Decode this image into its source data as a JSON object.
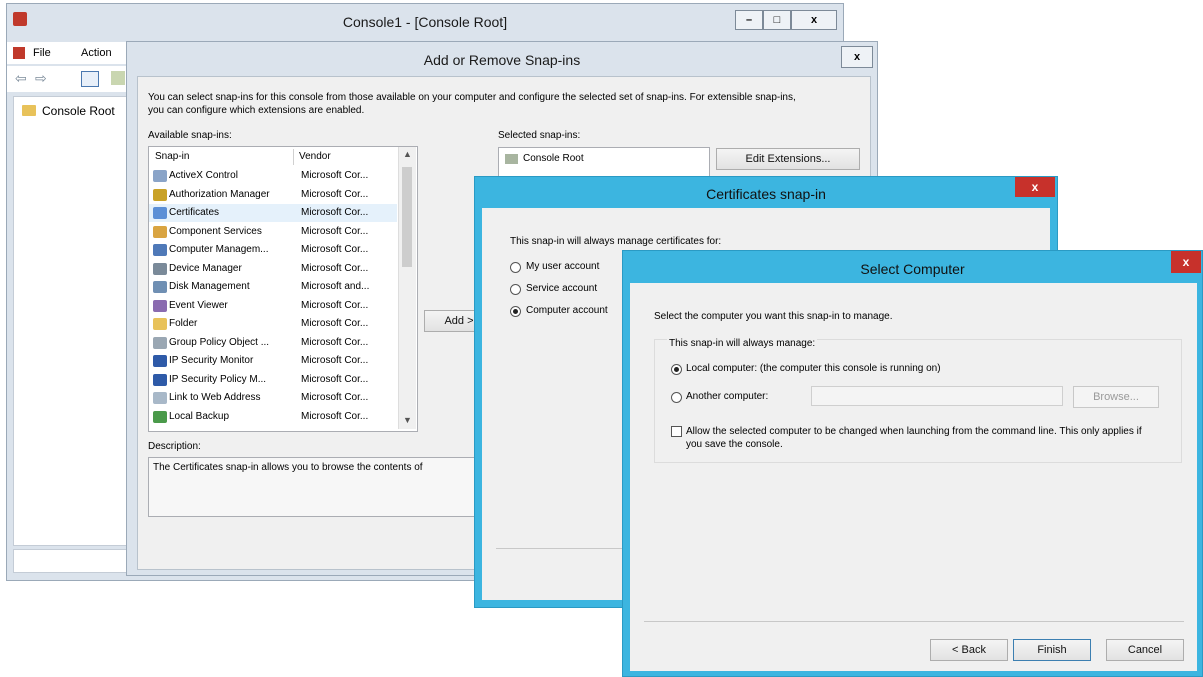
{
  "mmc": {
    "title": "Console1 - [Console Root]",
    "menu": [
      "File",
      "Action"
    ],
    "tree_root": "Console Root",
    "controls": {
      "minimize": "–",
      "maximize": "□",
      "close": "x"
    }
  },
  "add_remove": {
    "title": "Add or Remove Snap-ins",
    "close": "x",
    "intro": "You can select snap-ins for this console from those available on your computer and configure the selected set of snap-ins. For extensible snap-ins, you can configure which extensions are enabled.",
    "available_label": "Available snap-ins:",
    "columns": {
      "snapin": "Snap-in",
      "vendor": "Vendor"
    },
    "snapins": [
      {
        "name": "ActiveX Control",
        "vendor": "Microsoft Cor...",
        "icon": "activex-icon",
        "color": "#8aa4c8"
      },
      {
        "name": "Authorization Manager",
        "vendor": "Microsoft Cor...",
        "icon": "authorization-icon",
        "color": "#c9a227"
      },
      {
        "name": "Certificates",
        "vendor": "Microsoft Cor...",
        "icon": "certificates-icon",
        "color": "#5b8fd6"
      },
      {
        "name": "Component Services",
        "vendor": "Microsoft Cor...",
        "icon": "component-services-icon",
        "color": "#d9a441"
      },
      {
        "name": "Computer Managem...",
        "vendor": "Microsoft Cor...",
        "icon": "computer-management-icon",
        "color": "#4f79b8"
      },
      {
        "name": "Device Manager",
        "vendor": "Microsoft Cor...",
        "icon": "device-manager-icon",
        "color": "#7a8a99"
      },
      {
        "name": "Disk Management",
        "vendor": "Microsoft and...",
        "icon": "disk-management-icon",
        "color": "#6f8fb3"
      },
      {
        "name": "Event Viewer",
        "vendor": "Microsoft Cor...",
        "icon": "event-viewer-icon",
        "color": "#8a6bb0"
      },
      {
        "name": "Folder",
        "vendor": "Microsoft Cor...",
        "icon": "folder-icon",
        "color": "#e8c25a"
      },
      {
        "name": "Group Policy Object ...",
        "vendor": "Microsoft Cor...",
        "icon": "group-policy-icon",
        "color": "#9aa7b3"
      },
      {
        "name": "IP Security Monitor",
        "vendor": "Microsoft Cor...",
        "icon": "ip-security-monitor-icon",
        "color": "#2e5aa8"
      },
      {
        "name": "IP Security Policy M...",
        "vendor": "Microsoft Cor...",
        "icon": "ip-security-policy-icon",
        "color": "#2e5aa8"
      },
      {
        "name": "Link to Web Address",
        "vendor": "Microsoft Cor...",
        "icon": "link-icon",
        "color": "#a8b8c8"
      },
      {
        "name": "Local Backup",
        "vendor": "Microsoft Cor...",
        "icon": "local-backup-icon",
        "color": "#4a9a4a"
      }
    ],
    "add_button": "Add >",
    "selected_label": "Selected snap-ins:",
    "selected_items": [
      "Console Root"
    ],
    "edit_extensions": "Edit Extensions...",
    "description_label": "Description:",
    "description": "The Certificates snap-in allows you to browse the contents of"
  },
  "cert_snapin": {
    "title": "Certificates snap-in",
    "close": "x",
    "prompt": "This snap-in will always manage certificates for:",
    "options": [
      "My user account",
      "Service account",
      "Computer account"
    ],
    "selected_index": 2
  },
  "select_computer": {
    "title": "Select Computer",
    "close": "x",
    "prompt": "Select the computer you want this snap-in to manage.",
    "group_label": "This snap-in will always manage:",
    "local_label": "Local computer:  (the computer this console is running on)",
    "another_label": "Another computer:",
    "another_value": "",
    "browse": "Browse...",
    "allow_change": "Allow the selected computer to be changed when launching from the command line.  This only applies if you save the console.",
    "allow_checked": false,
    "back": "< Back",
    "finish": "Finish",
    "cancel": "Cancel"
  }
}
